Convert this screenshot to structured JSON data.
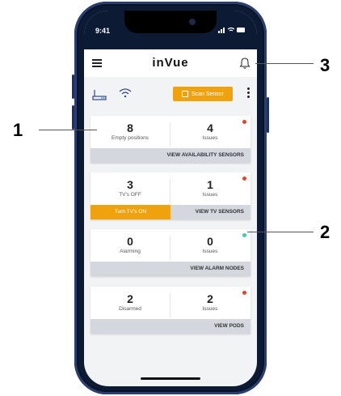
{
  "status": {
    "time": "9:41",
    "icons": " ıll ◠ ▬"
  },
  "header": {
    "logo": "inVue"
  },
  "toolbar": {
    "scan_label": "Scan Sensor"
  },
  "cards": [
    {
      "left_value": "8",
      "left_label": "Empty positions",
      "right_value": "4",
      "right_label": "Issues",
      "footer": "VIEW AVAILABILITY SENSORS",
      "dot_color": "#e0442b"
    },
    {
      "left_value": "3",
      "left_label": "TV's OFF",
      "right_value": "1",
      "right_label": "Issues",
      "action": "Turn TV's ON",
      "footer": "VIEW TV SENSORS",
      "dot_color": "#e0442b"
    },
    {
      "left_value": "0",
      "left_label": "Alarming",
      "right_value": "0",
      "right_label": "Issues",
      "footer": "VIEW ALARM NODES",
      "dot_color": "#3fcf9a"
    },
    {
      "left_value": "2",
      "left_label": "Disarmed",
      "right_value": "2",
      "right_label": "Issues",
      "footer": "VIEW PODS",
      "dot_color": "#e0442b"
    }
  ],
  "callouts": {
    "one": "1",
    "two": "2",
    "three": "3"
  },
  "colors": {
    "accent": "#f0a20e",
    "phone": "#0d1a33",
    "alert": "#e0442b",
    "ok": "#3fcf9a"
  }
}
